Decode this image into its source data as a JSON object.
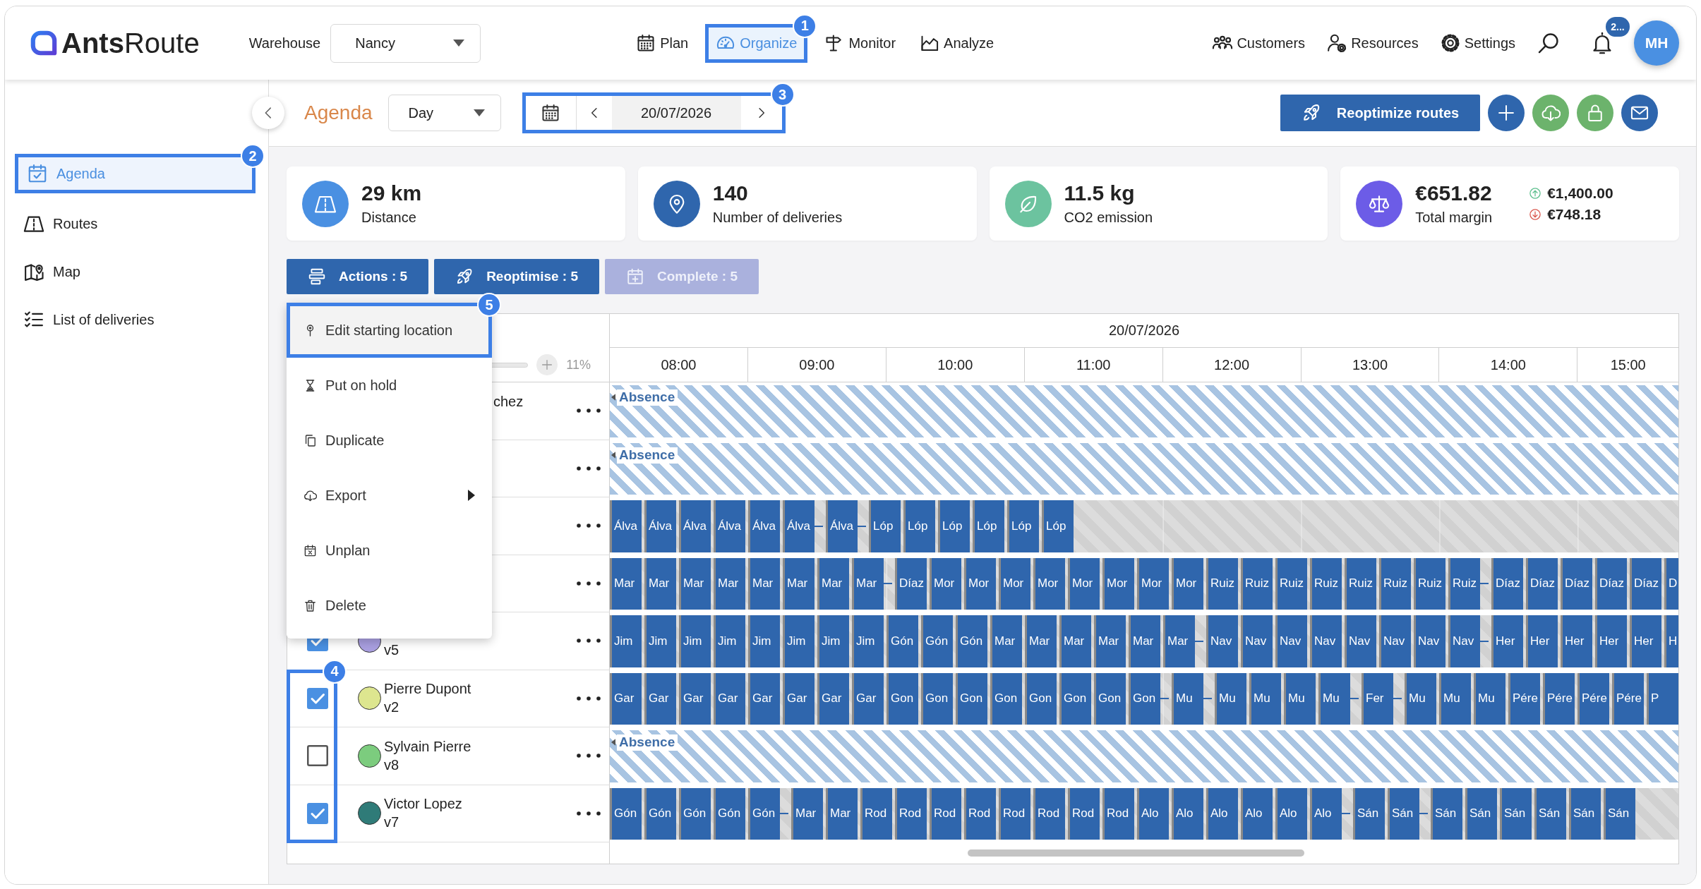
{
  "header": {
    "brand": "**Ants**Route",
    "warehouse": {
      "label": "Warehouse",
      "value": "Nancy"
    },
    "nav": [
      {
        "label": "Plan",
        "selected": false
      },
      {
        "label": "Organize",
        "selected": true,
        "callout": "1"
      },
      {
        "label": "Monitor",
        "selected": false
      },
      {
        "label": "Analyze",
        "selected": false
      }
    ],
    "links": [
      {
        "label": "Customers"
      },
      {
        "label": "Resources"
      },
      {
        "label": "Settings"
      }
    ],
    "notifications": {
      "badge": "2..."
    },
    "avatar": "MH"
  },
  "sidebar": {
    "items": [
      {
        "label": "Agenda",
        "selected": true,
        "callout": "2"
      },
      {
        "label": "Routes",
        "selected": false
      },
      {
        "label": "Map",
        "selected": false
      },
      {
        "label": "List of deliveries",
        "selected": false
      }
    ]
  },
  "toolbar": {
    "title": "Agenda",
    "view": "Day",
    "date": "20/07/2026",
    "callout": "3",
    "reoptimize": "Reoptimize routes",
    "round_buttons": [
      {
        "color": "#2f66ad"
      },
      {
        "color": "#6cb36c"
      },
      {
        "color": "#6cb36c"
      },
      {
        "color": "#2f66ad"
      }
    ]
  },
  "stats": [
    {
      "value": "29 km",
      "label": "Distance",
      "color": "#4a90e2"
    },
    {
      "value": "140",
      "label": "Number of deliveries",
      "color": "#2f66ad"
    },
    {
      "value": "11.5 kg",
      "label": "CO2 emission",
      "color": "#6cc39f"
    },
    {
      "value": "€651.82",
      "label": "Total margin",
      "color": "#6c5ce7",
      "details": [
        {
          "kind": "up",
          "value": "€1,400.00"
        },
        {
          "kind": "down",
          "value": "€748.18"
        }
      ]
    }
  ],
  "actions": [
    {
      "label": "Actions : 5",
      "disabled": false
    },
    {
      "label": "Reoptimise : 5",
      "disabled": false
    },
    {
      "label": "Complete : 5",
      "disabled": true
    }
  ],
  "menu": {
    "items": [
      {
        "label": "Edit starting location",
        "selected": true,
        "submenu": false,
        "callout": "5"
      },
      {
        "label": "Put on hold",
        "selected": false,
        "submenu": false
      },
      {
        "label": "Duplicate",
        "selected": false,
        "submenu": false
      },
      {
        "label": "Export",
        "selected": false,
        "submenu": true
      },
      {
        "label": "Unplan",
        "selected": false,
        "submenu": false
      },
      {
        "label": "Delete",
        "selected": false,
        "submenu": false
      }
    ]
  },
  "table": {
    "zoom": "11%",
    "date": "20/07/2026",
    "hours": [
      "08:00",
      "09:00",
      "10:00",
      "11:00",
      "12:00",
      "13:00",
      "14:00",
      "15:00"
    ],
    "callout": "4",
    "rows": [
      {
        "kind": "covered",
        "name": "chez",
        "in_callout": false,
        "timeline": {
          "kind": "absence",
          "label": "Absence"
        }
      },
      {
        "kind": "covered",
        "in_callout": false,
        "timeline": {
          "kind": "absence",
          "label": "Absence"
        }
      },
      {
        "kind": "covered",
        "in_callout": false,
        "timeline": {
          "kind": "tasks",
          "blocks": [
            {
              "kind": "task",
              "label": "Álva"
            },
            {
              "kind": "task",
              "label": "Álva"
            },
            {
              "kind": "task",
              "label": "Álva"
            },
            {
              "kind": "task",
              "label": "Álva"
            },
            {
              "kind": "task",
              "label": "Álva"
            },
            {
              "kind": "task",
              "label": "Álva"
            },
            {
              "kind": "travel"
            },
            {
              "kind": "task",
              "label": "Álva"
            },
            {
              "kind": "travel"
            },
            {
              "kind": "task",
              "label": "Lóp"
            },
            {
              "kind": "task",
              "label": "Lóp"
            },
            {
              "kind": "task",
              "label": "Lóp"
            },
            {
              "kind": "task",
              "label": "Lóp"
            },
            {
              "kind": "task",
              "label": "Lóp"
            },
            {
              "kind": "task",
              "label": "Lóp"
            }
          ]
        }
      },
      {
        "kind": "covered",
        "in_callout": false,
        "timeline": {
          "kind": "tasks",
          "blocks": [
            {
              "kind": "task",
              "label": "Mar"
            },
            {
              "kind": "task",
              "label": "Mar"
            },
            {
              "kind": "task",
              "label": "Mar"
            },
            {
              "kind": "task",
              "label": "Mar"
            },
            {
              "kind": "task",
              "label": "Mar"
            },
            {
              "kind": "task",
              "label": "Mar"
            },
            {
              "kind": "task",
              "label": "Mar"
            },
            {
              "kind": "task",
              "label": "Mar"
            },
            {
              "kind": "travel"
            },
            {
              "kind": "task",
              "label": "Díaz"
            },
            {
              "kind": "task",
              "label": "Mor"
            },
            {
              "kind": "task",
              "label": "Mor"
            },
            {
              "kind": "task",
              "label": "Mor"
            },
            {
              "kind": "task",
              "label": "Mor"
            },
            {
              "kind": "task",
              "label": "Mor"
            },
            {
              "kind": "task",
              "label": "Mor"
            },
            {
              "kind": "task",
              "label": "Mor"
            },
            {
              "kind": "task",
              "label": "Mor"
            },
            {
              "kind": "task",
              "label": "Ruiz"
            },
            {
              "kind": "task",
              "label": "Ruiz"
            },
            {
              "kind": "task",
              "label": "Ruiz"
            },
            {
              "kind": "task",
              "label": "Ruiz"
            },
            {
              "kind": "task",
              "label": "Ruiz"
            },
            {
              "kind": "task",
              "label": "Ruiz"
            },
            {
              "kind": "task",
              "label": "Ruiz"
            },
            {
              "kind": "task",
              "label": "Ruiz"
            },
            {
              "kind": "travel"
            },
            {
              "kind": "task",
              "label": "Díaz"
            },
            {
              "kind": "task",
              "label": "Díaz"
            },
            {
              "kind": "task",
              "label": "Díaz"
            },
            {
              "kind": "task",
              "label": "Díaz"
            },
            {
              "kind": "task",
              "label": "Díaz"
            },
            {
              "kind": "edge",
              "label": "D"
            }
          ]
        }
      },
      {
        "kind": "full",
        "checked": true,
        "color": "#a99fe0",
        "vehicle": "v5",
        "in_callout": false,
        "timeline": {
          "kind": "tasks",
          "blocks": [
            {
              "kind": "task",
              "label": "Jim"
            },
            {
              "kind": "task",
              "label": "Jim"
            },
            {
              "kind": "task",
              "label": "Jim"
            },
            {
              "kind": "task",
              "label": "Jim"
            },
            {
              "kind": "task",
              "label": "Jim"
            },
            {
              "kind": "task",
              "label": "Jim"
            },
            {
              "kind": "task",
              "label": "Jim"
            },
            {
              "kind": "task",
              "label": "Jim"
            },
            {
              "kind": "task",
              "label": "Gón"
            },
            {
              "kind": "task",
              "label": "Gón"
            },
            {
              "kind": "task",
              "label": "Gón"
            },
            {
              "kind": "task",
              "label": "Mar"
            },
            {
              "kind": "task",
              "label": "Mar"
            },
            {
              "kind": "task",
              "label": "Mar"
            },
            {
              "kind": "task",
              "label": "Mar"
            },
            {
              "kind": "task",
              "label": "Mar"
            },
            {
              "kind": "task",
              "label": "Mar"
            },
            {
              "kind": "travel"
            },
            {
              "kind": "task",
              "label": "Nav"
            },
            {
              "kind": "task",
              "label": "Nav"
            },
            {
              "kind": "task",
              "label": "Nav"
            },
            {
              "kind": "task",
              "label": "Nav"
            },
            {
              "kind": "task",
              "label": "Nav"
            },
            {
              "kind": "task",
              "label": "Nav"
            },
            {
              "kind": "task",
              "label": "Nav"
            },
            {
              "kind": "task",
              "label": "Nav"
            },
            {
              "kind": "travel"
            },
            {
              "kind": "task",
              "label": "Her"
            },
            {
              "kind": "task",
              "label": "Her"
            },
            {
              "kind": "task",
              "label": "Her"
            },
            {
              "kind": "task",
              "label": "Her"
            },
            {
              "kind": "task",
              "label": "Her"
            },
            {
              "kind": "edge",
              "label": "H"
            }
          ]
        }
      },
      {
        "kind": "full",
        "checked": true,
        "color": "#dde68f",
        "name": "Pierre Dupont",
        "vehicle": "v2",
        "in_callout": true,
        "timeline": {
          "kind": "tasks",
          "blocks": [
            {
              "kind": "task",
              "label": "Gar"
            },
            {
              "kind": "task",
              "label": "Gar"
            },
            {
              "kind": "task",
              "label": "Gar"
            },
            {
              "kind": "task",
              "label": "Gar"
            },
            {
              "kind": "task",
              "label": "Gar"
            },
            {
              "kind": "task",
              "label": "Gar"
            },
            {
              "kind": "task",
              "label": "Gar"
            },
            {
              "kind": "task",
              "label": "Gar"
            },
            {
              "kind": "task",
              "label": "Gon"
            },
            {
              "kind": "task",
              "label": "Gon"
            },
            {
              "kind": "task",
              "label": "Gon"
            },
            {
              "kind": "task",
              "label": "Gon"
            },
            {
              "kind": "task",
              "label": "Gon"
            },
            {
              "kind": "task",
              "label": "Gon"
            },
            {
              "kind": "task",
              "label": "Gon"
            },
            {
              "kind": "task",
              "label": "Gon"
            },
            {
              "kind": "travel"
            },
            {
              "kind": "task",
              "label": "Mu"
            },
            {
              "kind": "travel"
            },
            {
              "kind": "task",
              "label": "Mu"
            },
            {
              "kind": "task",
              "label": "Mu"
            },
            {
              "kind": "task",
              "label": "Mu"
            },
            {
              "kind": "task",
              "label": "Mu"
            },
            {
              "kind": "travel"
            },
            {
              "kind": "task",
              "label": "Fer"
            },
            {
              "kind": "travel"
            },
            {
              "kind": "task",
              "label": "Mu"
            },
            {
              "kind": "task",
              "label": "Mu"
            },
            {
              "kind": "task",
              "label": "Mu"
            },
            {
              "kind": "task",
              "label": "Pére"
            },
            {
              "kind": "task",
              "label": "Pére"
            },
            {
              "kind": "task",
              "label": "Pére"
            },
            {
              "kind": "task",
              "label": "Pére"
            },
            {
              "kind": "edge",
              "label": "P"
            }
          ]
        }
      },
      {
        "kind": "full",
        "checked": false,
        "color": "#7ccc7e",
        "name": "Sylvain Pierre",
        "vehicle": "v8",
        "in_callout": true,
        "timeline": {
          "kind": "absence",
          "label": "Absence"
        }
      },
      {
        "kind": "full",
        "checked": true,
        "color": "#2f7b78",
        "name": "Victor Lopez",
        "vehicle": "v7",
        "in_callout": true,
        "timeline": {
          "kind": "tasks",
          "blocks": [
            {
              "kind": "task",
              "label": "Gón"
            },
            {
              "kind": "task",
              "label": "Gón"
            },
            {
              "kind": "task",
              "label": "Gón"
            },
            {
              "kind": "task",
              "label": "Gón"
            },
            {
              "kind": "task",
              "label": "Gón"
            },
            {
              "kind": "travel"
            },
            {
              "kind": "task",
              "label": "Mar"
            },
            {
              "kind": "task",
              "label": "Mar"
            },
            {
              "kind": "task",
              "label": "Rod"
            },
            {
              "kind": "task",
              "label": "Rod"
            },
            {
              "kind": "task",
              "label": "Rod"
            },
            {
              "kind": "task",
              "label": "Rod"
            },
            {
              "kind": "task",
              "label": "Rod"
            },
            {
              "kind": "task",
              "label": "Rod"
            },
            {
              "kind": "task",
              "label": "Rod"
            },
            {
              "kind": "task",
              "label": "Rod"
            },
            {
              "kind": "task",
              "label": "Alo"
            },
            {
              "kind": "task",
              "label": "Alo"
            },
            {
              "kind": "task",
              "label": "Alo"
            },
            {
              "kind": "task",
              "label": "Alo"
            },
            {
              "kind": "task",
              "label": "Alo"
            },
            {
              "kind": "task",
              "label": "Alo"
            },
            {
              "kind": "travel"
            },
            {
              "kind": "task",
              "label": "Sán"
            },
            {
              "kind": "task",
              "label": "Sán"
            },
            {
              "kind": "travel"
            },
            {
              "kind": "task",
              "label": "Sán"
            },
            {
              "kind": "task",
              "label": "Sán"
            },
            {
              "kind": "task",
              "label": "Sán"
            },
            {
              "kind": "task",
              "label": "Sán"
            },
            {
              "kind": "task",
              "label": "Sán"
            },
            {
              "kind": "task",
              "label": "Sán"
            }
          ]
        }
      }
    ]
  }
}
